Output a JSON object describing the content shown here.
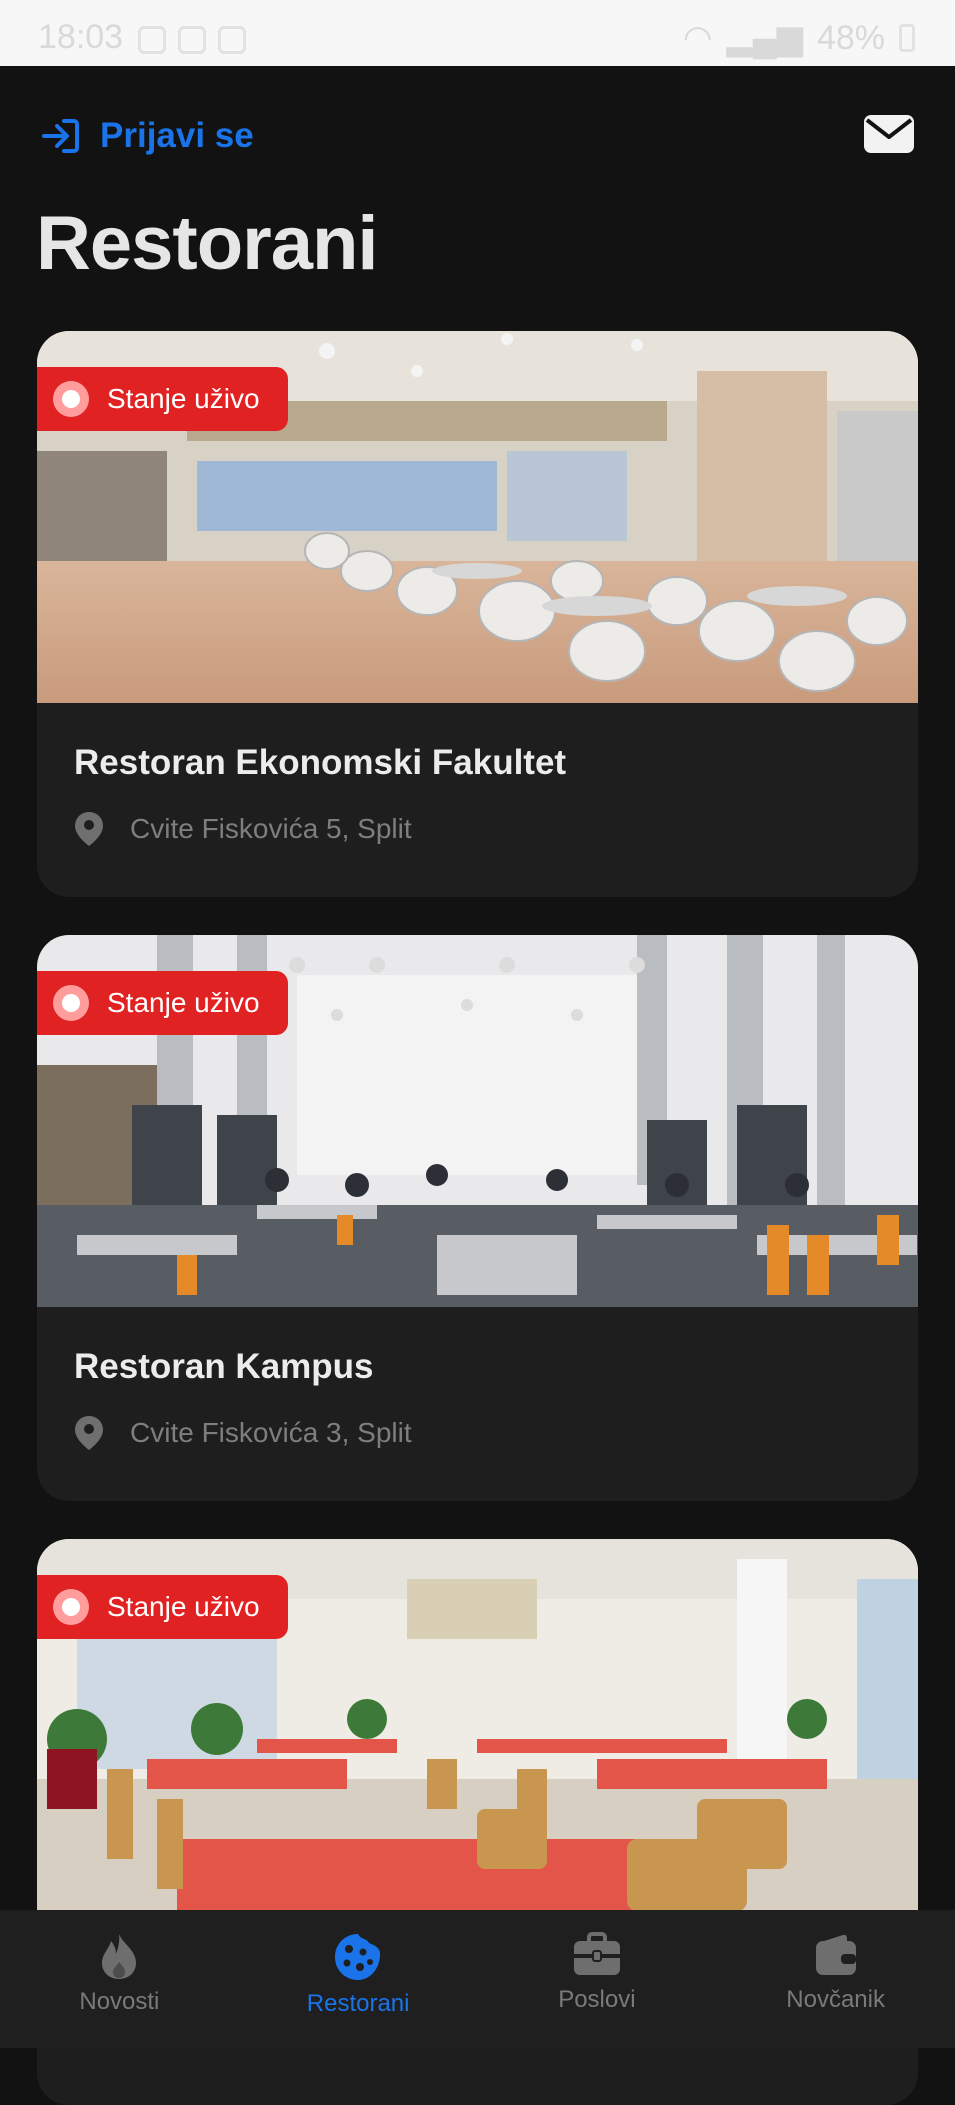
{
  "status_bar": {
    "time": "18:03",
    "battery": "48%"
  },
  "header": {
    "login_label": "Prijavi se",
    "mail_icon": "mail-icon"
  },
  "page_title": "Restorani",
  "restaurants": [
    {
      "name": "Restoran Ekonomski Fakultet",
      "address": "Cvite Fiskovića 5, Split",
      "badge": "Stanje uživo"
    },
    {
      "name": "Restoran Kampus",
      "address": "Cvite Fiskovića 3, Split",
      "badge": "Stanje uživo"
    },
    {
      "name": "",
      "address": "",
      "badge": "Stanje uživo"
    }
  ],
  "nav": [
    {
      "label": "Novosti",
      "icon": "flame-icon",
      "active": false
    },
    {
      "label": "Restorani",
      "icon": "cookie-icon",
      "active": true
    },
    {
      "label": "Poslovi",
      "icon": "briefcase-icon",
      "active": false
    },
    {
      "label": "Novčanik",
      "icon": "wallet-icon",
      "active": false
    }
  ],
  "colors": {
    "accent": "#1a73e8",
    "live_badge": "#e02222",
    "background": "#121212",
    "card": "#1e1e1e"
  }
}
